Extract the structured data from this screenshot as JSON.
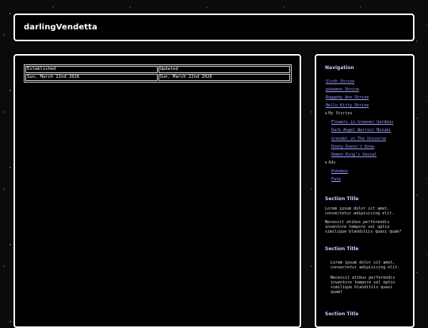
{
  "header": {
    "site_title": "darlingVendetta"
  },
  "main": {
    "table": {
      "headers": [
        "Established",
        "Updated"
      ],
      "values": [
        "Sun, March 22nd 2026",
        "Sun, March 22nd 2026"
      ]
    }
  },
  "sidebar": {
    "nav_heading": "Navigation",
    "links": [
      "Sloth Shrine",
      "pokémon Shrine",
      "Raggedy Ann Shrine",
      "Hello Kitty Shrine"
    ],
    "folders": [
      {
        "label": "My Stories",
        "expanded": true,
        "items": [
          "Flowers in Greener Gardens",
          "Dark Angel Warrior Noxumi",
          "Grendel vs The Universe",
          "Donny Doesn't Know",
          "Demon King's Vassal"
        ]
      },
      {
        "label": "Ads",
        "expanded": true,
        "items": [
          "Pokémon",
          "Fate"
        ]
      }
    ],
    "sections": [
      {
        "title": "Section Title",
        "paragraphs": [
          "Lorem ipsum dolor sit amet, consectetur adipisicing elit.",
          "Necessit atibus perferendis inventore tempore vel optio similique blanditiis quasi quam?"
        ]
      },
      {
        "title": "Section Title",
        "paragraphs": [
          "Lorem ipsum dolor sit amet, consectetur adipisicing elit.",
          "Necessit atibus perferendis inventore tempore vel optio similique blanditiis quasi quam?"
        ]
      },
      {
        "title": "Section Title",
        "paragraphs": []
      }
    ]
  }
}
